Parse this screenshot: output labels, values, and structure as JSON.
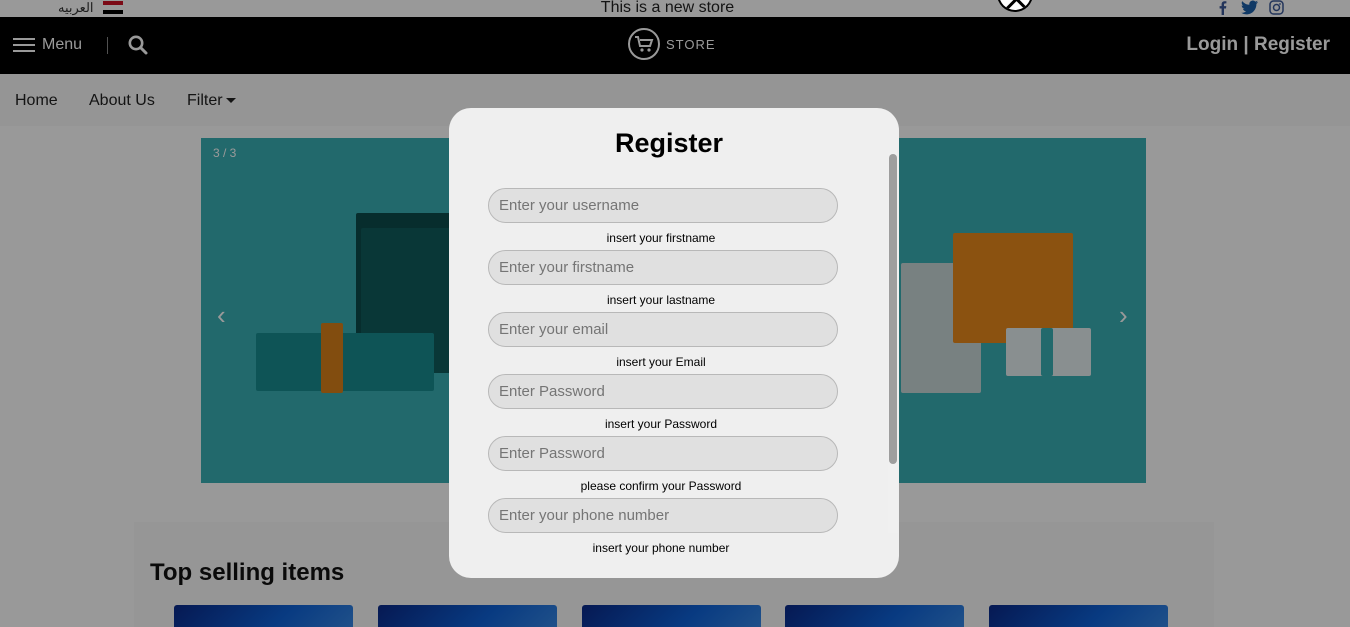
{
  "topbar": {
    "lang_label": "العربيه",
    "announcement": "This is a new store",
    "social_icons": [
      "facebook-icon",
      "twitter-icon",
      "instagram-icon"
    ]
  },
  "header": {
    "menu_label": "Menu",
    "logo_text": "STORE",
    "auth_label": "Login | Register"
  },
  "nav": {
    "items": [
      "Home",
      "About Us",
      "Filter"
    ]
  },
  "carousel": {
    "counter": "3 / 3",
    "prev_glyph": "‹",
    "next_glyph": "›"
  },
  "section": {
    "title": "Top selling items"
  },
  "modal": {
    "title": "Register",
    "fields": [
      {
        "placeholder": "Enter your username",
        "hint": "insert your firstname"
      },
      {
        "placeholder": "Enter your firstname",
        "hint": "insert your lastname"
      },
      {
        "placeholder": "Enter your email",
        "hint": "insert your Email"
      },
      {
        "placeholder": "Enter Password",
        "hint": "insert your Password"
      },
      {
        "placeholder": "Enter Password",
        "hint": "please confirm your Password"
      },
      {
        "placeholder": "Enter your phone number",
        "hint": "insert your phone number"
      }
    ]
  },
  "colors": {
    "header_bg": "#000000",
    "carousel_bg": "#3aafb4",
    "modal_bg": "#efefef",
    "overlay": "rgba(0,0,0,0.4)"
  }
}
